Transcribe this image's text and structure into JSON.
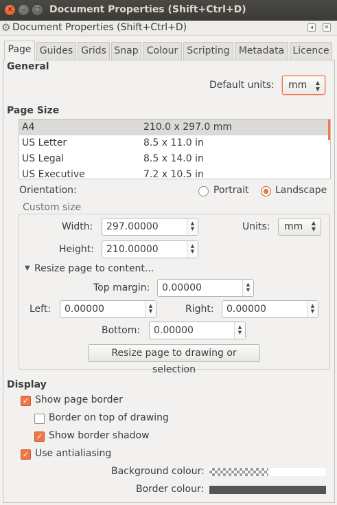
{
  "window": {
    "title": "Document Properties (Shift+Ctrl+D)",
    "close_glyph": "✕",
    "minimize_glyph": "–",
    "maximize_glyph": "□"
  },
  "dock": {
    "title": "Document Properties (Shift+Ctrl+D)",
    "gear_glyph": "⚙",
    "left_glyph": "◂",
    "close_glyph": "✕"
  },
  "tabs": [
    {
      "label": "Page",
      "active": true
    },
    {
      "label": "Guides"
    },
    {
      "label": "Grids"
    },
    {
      "label": "Snap"
    },
    {
      "label": "Colour"
    },
    {
      "label": "Scripting"
    },
    {
      "label": "Metadata"
    },
    {
      "label": "Licence"
    }
  ],
  "general": {
    "heading": "General",
    "default_units_label": "Default units:",
    "default_units_value": "mm"
  },
  "page_size": {
    "heading": "Page Size",
    "rows": [
      {
        "name": "A4",
        "size": "210.0 x 297.0 mm",
        "selected": true
      },
      {
        "name": "US Letter",
        "size": "8.5 x 11.0 in"
      },
      {
        "name": "US Legal",
        "size": "8.5 x 14.0 in"
      },
      {
        "name": "US Executive",
        "size": "7.2 x 10.5 in"
      }
    ]
  },
  "orientation": {
    "label": "Orientation:",
    "portrait": "Portrait",
    "landscape": "Landscape",
    "selected": "Landscape"
  },
  "custom_size": {
    "legend": "Custom size",
    "width_label": "Width:",
    "width_value": "297.00000",
    "height_label": "Height:",
    "height_value": "210.00000",
    "units_label": "Units:",
    "units_value": "mm",
    "resize_expander": "Resize page to content...",
    "expander_glyph": "▼",
    "top_margin_label": "Top margin:",
    "top_margin_value": "0.00000",
    "left_label": "Left:",
    "left_value": "0.00000",
    "right_label": "Right:",
    "right_value": "0.00000",
    "bottom_label": "Bottom:",
    "bottom_value": "0.00000",
    "resize_button": "Resize page to drawing or selection"
  },
  "display": {
    "heading": "Display",
    "show_page_border": {
      "label": "Show page border",
      "checked": true
    },
    "border_on_top": {
      "label": "Border on top of drawing",
      "checked": false
    },
    "show_border_shadow": {
      "label": "Show border shadow",
      "checked": true
    },
    "use_antialiasing": {
      "label": "Use antialiasing",
      "checked": true
    },
    "background_colour_label": "Background colour:",
    "border_colour_label": "Border colour:",
    "border_colour": "#555555",
    "check_glyph": "✓"
  },
  "accent_color": "#f07746",
  "spin_up": "▲",
  "spin_down": "▼"
}
